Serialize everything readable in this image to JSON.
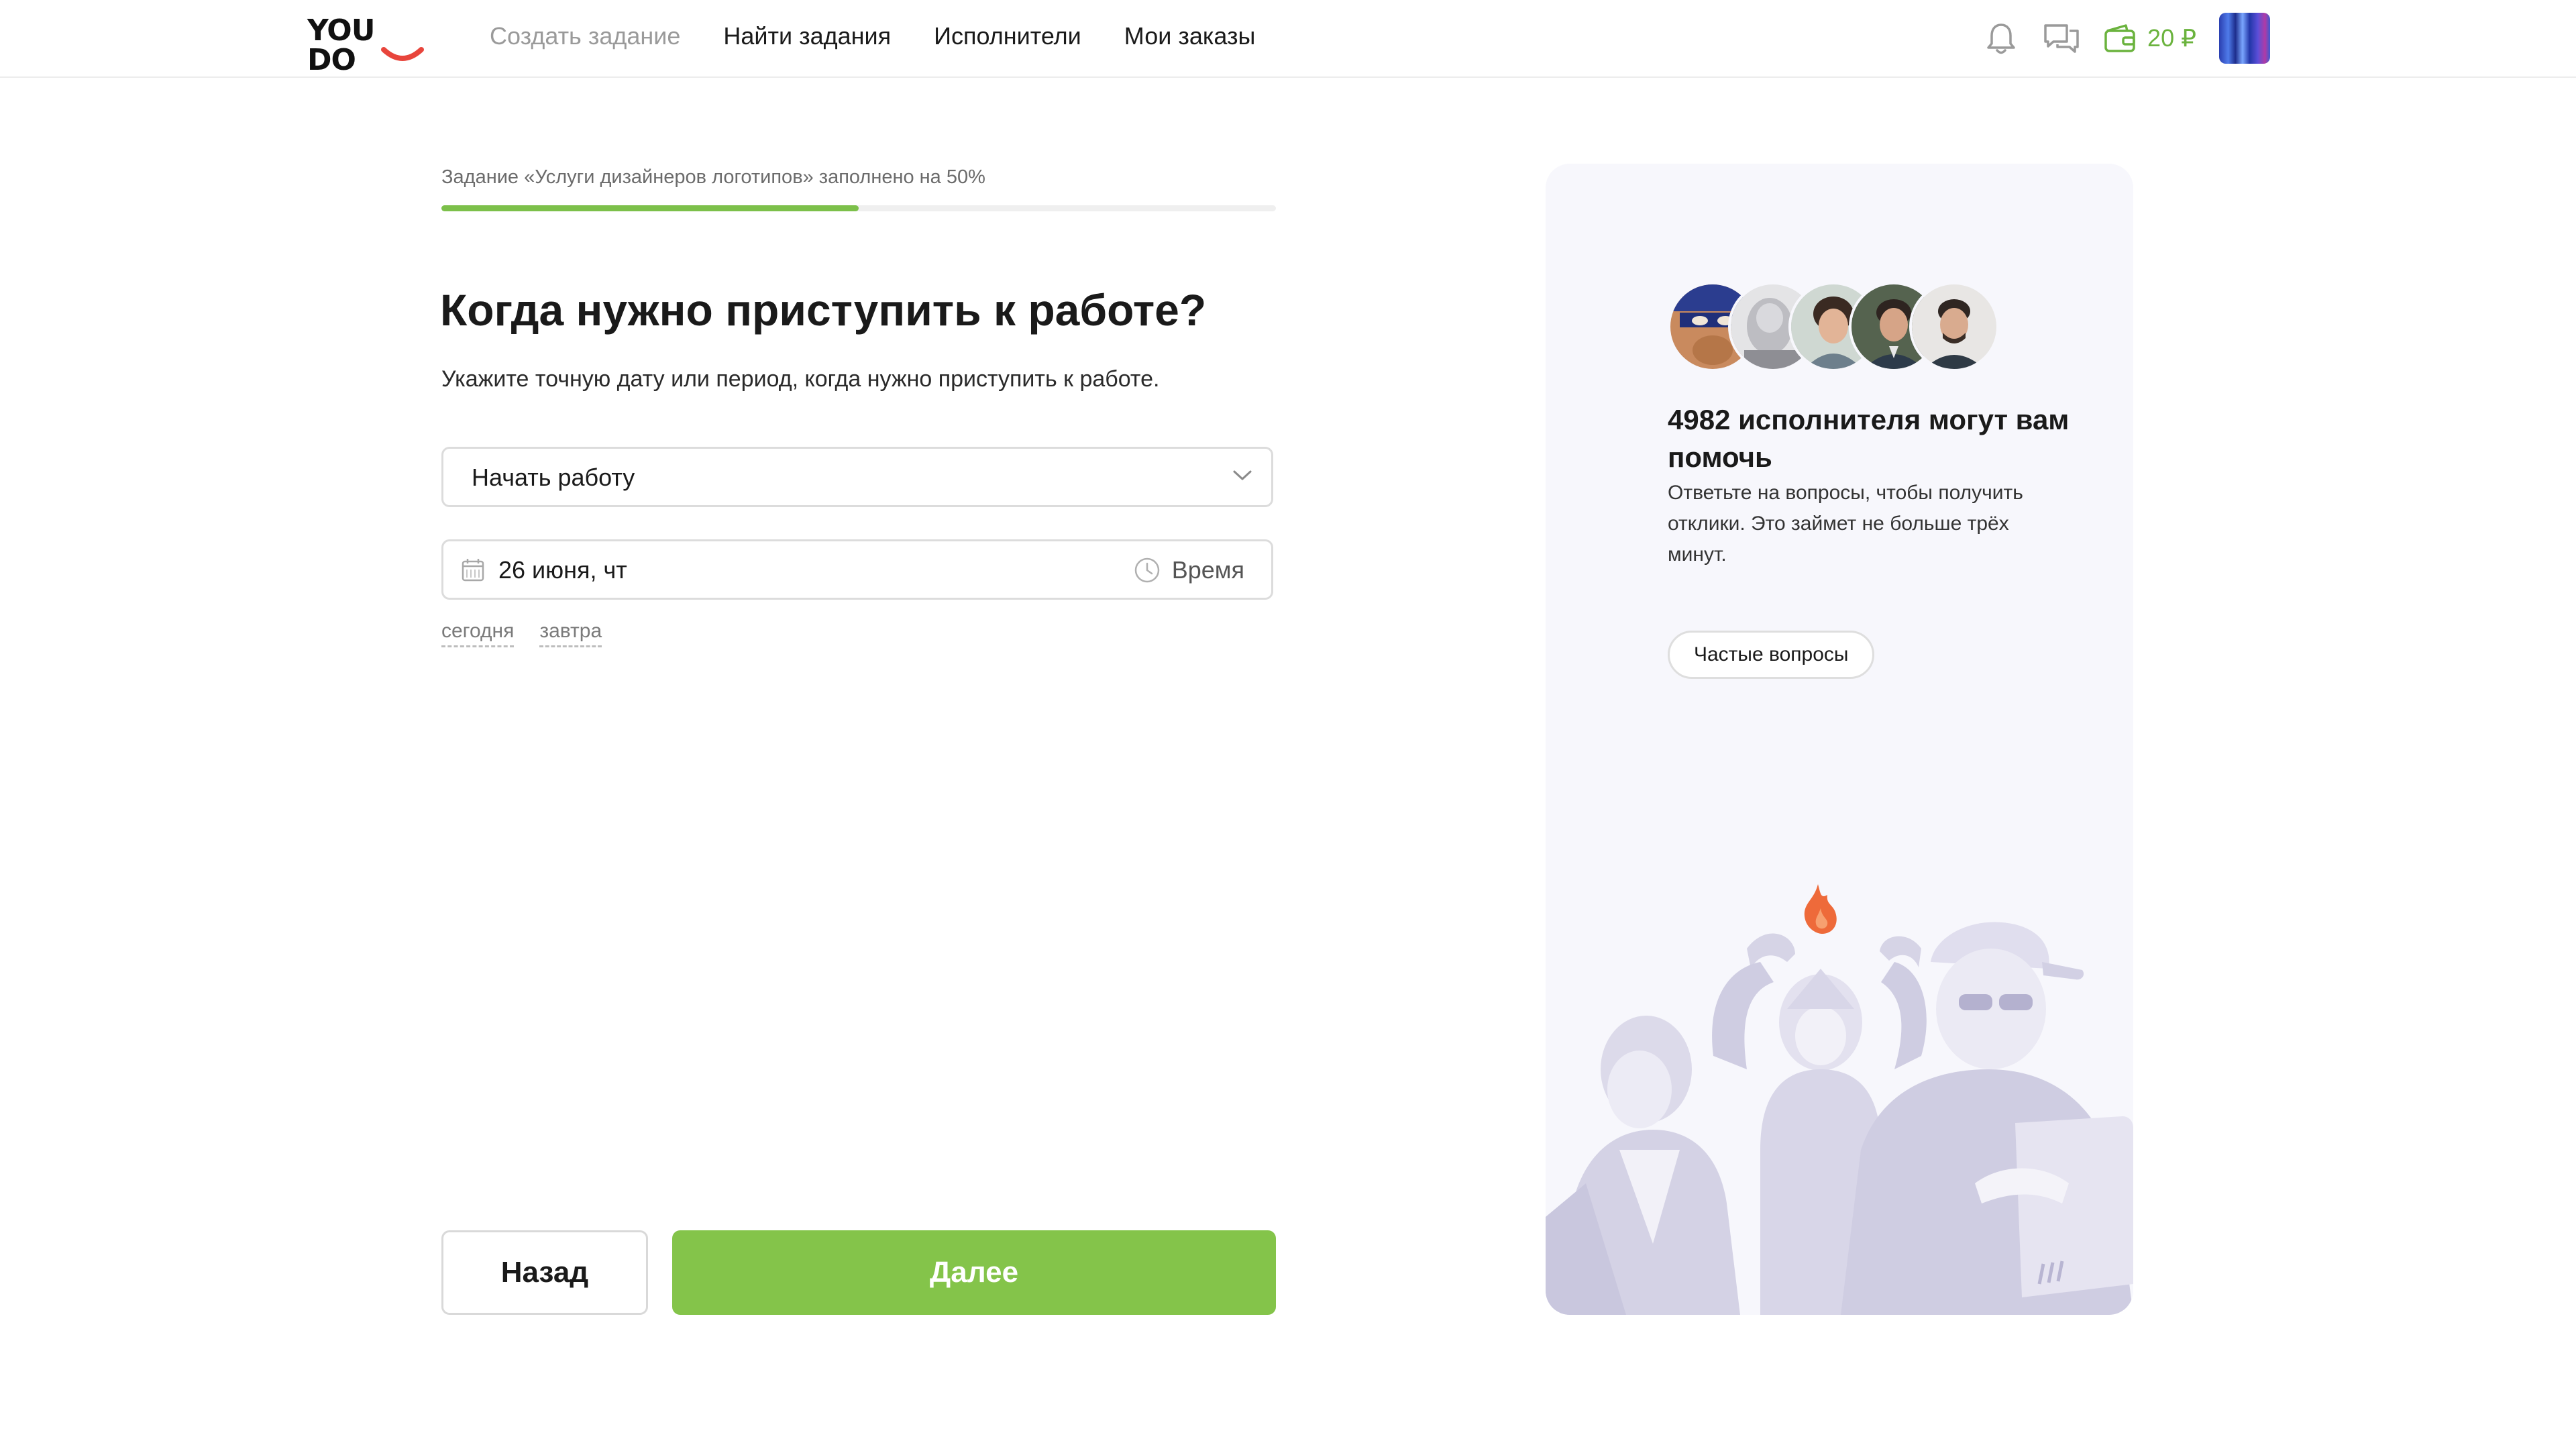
{
  "header": {
    "logo_text": "YOU DO",
    "nav": [
      {
        "label": "Создать задание"
      },
      {
        "label": "Найти задания"
      },
      {
        "label": "Исполнители"
      },
      {
        "label": "Мои заказы"
      }
    ],
    "balance": "20 ₽",
    "accent_color": "#6bb33e"
  },
  "form": {
    "progress_label": "Задание «Услуги дизайнеров логотипов» заполнено на 50%",
    "progress_percent": 50,
    "title": "Когда нужно приступить к работе?",
    "subtitle": "Укажите точную дату или период, когда нужно приступить к работе.",
    "start_select": {
      "value": "Начать работу"
    },
    "date": {
      "value": "26 июня, чт",
      "time_label": "Время"
    },
    "quick_links": [
      "сегодня",
      "завтра"
    ],
    "back_label": "Назад",
    "next_label": "Далее"
  },
  "sidebar": {
    "title": "4982 исполнителя могут вам помочь",
    "text": "Ответьте на вопросы, чтобы получить отклики. Это займет не больше трёх минут.",
    "faq_label": "Частые вопросы"
  }
}
